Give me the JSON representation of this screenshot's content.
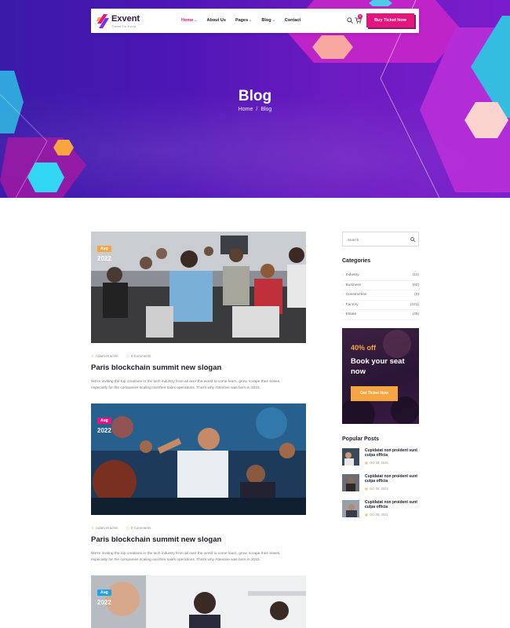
{
  "header": {
    "logo_name": "Exvent",
    "logo_tagline": "Theme For Event",
    "nav": [
      {
        "label": "Home",
        "active": true,
        "dropdown": true
      },
      {
        "label": "About Us",
        "active": false,
        "dropdown": false
      },
      {
        "label": "Pages",
        "active": false,
        "dropdown": true
      },
      {
        "label": "Blog",
        "active": false,
        "dropdown": true
      },
      {
        "label": "Contact",
        "active": false,
        "dropdown": false
      }
    ],
    "cart_count": "0",
    "cta_label": "Buy Ticket Now",
    "icons": {
      "search": "search-icon",
      "cart": "cart-icon",
      "chevron": "chevron-down-icon"
    }
  },
  "hero": {
    "title": "Blog",
    "breadcrumb": {
      "home": "Home",
      "separator": "/",
      "current": "Blog"
    }
  },
  "posts": [
    {
      "month": "Aug",
      "month_color": "#f7a541",
      "year": "2022",
      "author": "Adam Hrachin",
      "comments": "0 Comments",
      "title": "Paris blockchain summit new slogan",
      "excerpt": "We're inviting the top creatives in the tech industry from all over the world to come learn, grow, scrape their knees, especially for the companies scaling out their sales operations. That's why Attentive was born in 2015."
    },
    {
      "month": "Aug",
      "month_color": "#e5157e",
      "year": "2022",
      "author": "Adam Hrachin",
      "comments": "0 Comments",
      "title": "Paris blockchain summit new slogan",
      "excerpt": "We're inviting the top creatives in the tech industry from all over the world to come learn, grow, scrape their knees, especially for the companies scaling out their sales operations. That's why Attentive was born in 2015."
    },
    {
      "month": "Aug",
      "month_color": "#1aa3e8",
      "year": "2022"
    }
  ],
  "sidebar": {
    "search_placeholder": "Search",
    "categories_title": "Categories",
    "categories": [
      {
        "name": "Industry",
        "count": "(11)"
      },
      {
        "name": "Business",
        "count": "(02)"
      },
      {
        "name": "Construction",
        "count": "(0)"
      },
      {
        "name": "Factory",
        "count": "(231)"
      },
      {
        "name": "Estate",
        "count": "(45)"
      }
    ],
    "promo": {
      "discount": "40% off",
      "headline": "Book your seat now",
      "button": "Get Ticket Now"
    },
    "popular_title": "Popular Posts",
    "popular": [
      {
        "title": "Cupidatat non proident sunt culpa officia",
        "date": "Oct 09, 2021"
      },
      {
        "title": "Cupidatat non proident sunt culpa officia",
        "date": "Oct 09, 2021"
      },
      {
        "title": "Cupidatat non proident sunt culpa officia",
        "date": "Oct 09, 2021"
      }
    ]
  },
  "colors": {
    "accent_pink": "#e5157e",
    "accent_orange": "#f7a541",
    "hero_purple": "#5a18b8"
  }
}
